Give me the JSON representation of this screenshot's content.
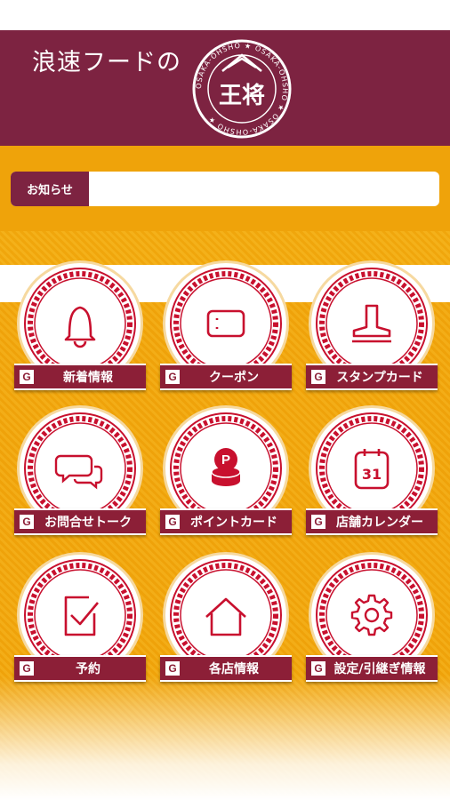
{
  "header": {
    "brand_text": "浪速フードの",
    "logo_text": "王将",
    "logo_ring_text": "OSAKA-OHSHO ★ OSAKA-OHSHO ★ OSAKA-OHSHO ★"
  },
  "notice": {
    "label": "お知らせ",
    "content": ""
  },
  "menu": [
    {
      "label": "新着情報",
      "icon": "bell-icon"
    },
    {
      "label": "クーポン",
      "icon": "coupon-icon"
    },
    {
      "label": "スタンプカード",
      "icon": "stamp-icon"
    },
    {
      "label": "お問合せトーク",
      "icon": "chat-icon"
    },
    {
      "label": "ポイントカード",
      "icon": "point-coins-icon"
    },
    {
      "label": "店舗カレンダー",
      "icon": "calendar-icon"
    },
    {
      "label": "予約",
      "icon": "checkbox-icon"
    },
    {
      "label": "各店情報",
      "icon": "home-icon"
    },
    {
      "label": "設定/引継ぎ情報",
      "icon": "gear-icon"
    }
  ],
  "badge_letter": "G",
  "calendar_day": "31",
  "colors": {
    "brand": "#7d2341",
    "accent": "#efa30a",
    "label_bg": "#8c1f37"
  }
}
